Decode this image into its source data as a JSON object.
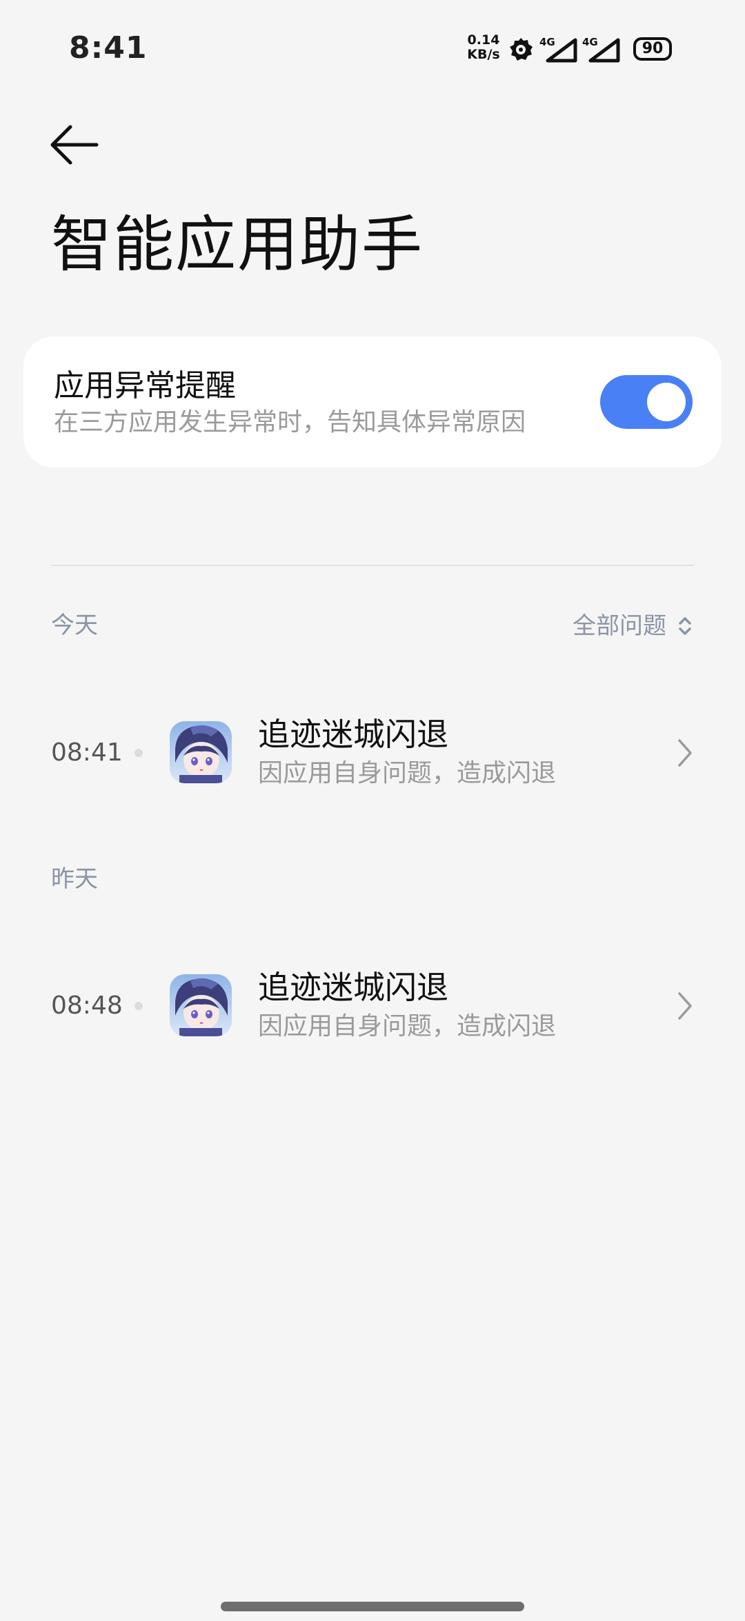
{
  "status_bar": {
    "time": "8:41",
    "net_speed_value": "0.14",
    "net_speed_unit": "KB/s",
    "sim1_label": "4G",
    "sim2_label": "4G",
    "battery_level": "90"
  },
  "header": {
    "back_icon": "arrow-left-icon",
    "title": "智能应用助手"
  },
  "alert_setting": {
    "title": "应用异常提醒",
    "description": "在三方应用发生异常时，告知具体异常原因",
    "enabled": true,
    "accent_color": "#4a80f5"
  },
  "filter": {
    "label": "全部问题",
    "icon": "sort-updown-icon"
  },
  "sections": [
    {
      "label": "今天",
      "items": [
        {
          "time": "08:41",
          "title": "追迹迷城闪退",
          "description": "因应用自身问题，造成闪退",
          "icon": "app-icon"
        }
      ]
    },
    {
      "label": "昨天",
      "items": [
        {
          "time": "08:48",
          "title": "追迹迷城闪退",
          "description": "因应用自身问题，造成闪退",
          "icon": "app-icon"
        }
      ]
    }
  ]
}
